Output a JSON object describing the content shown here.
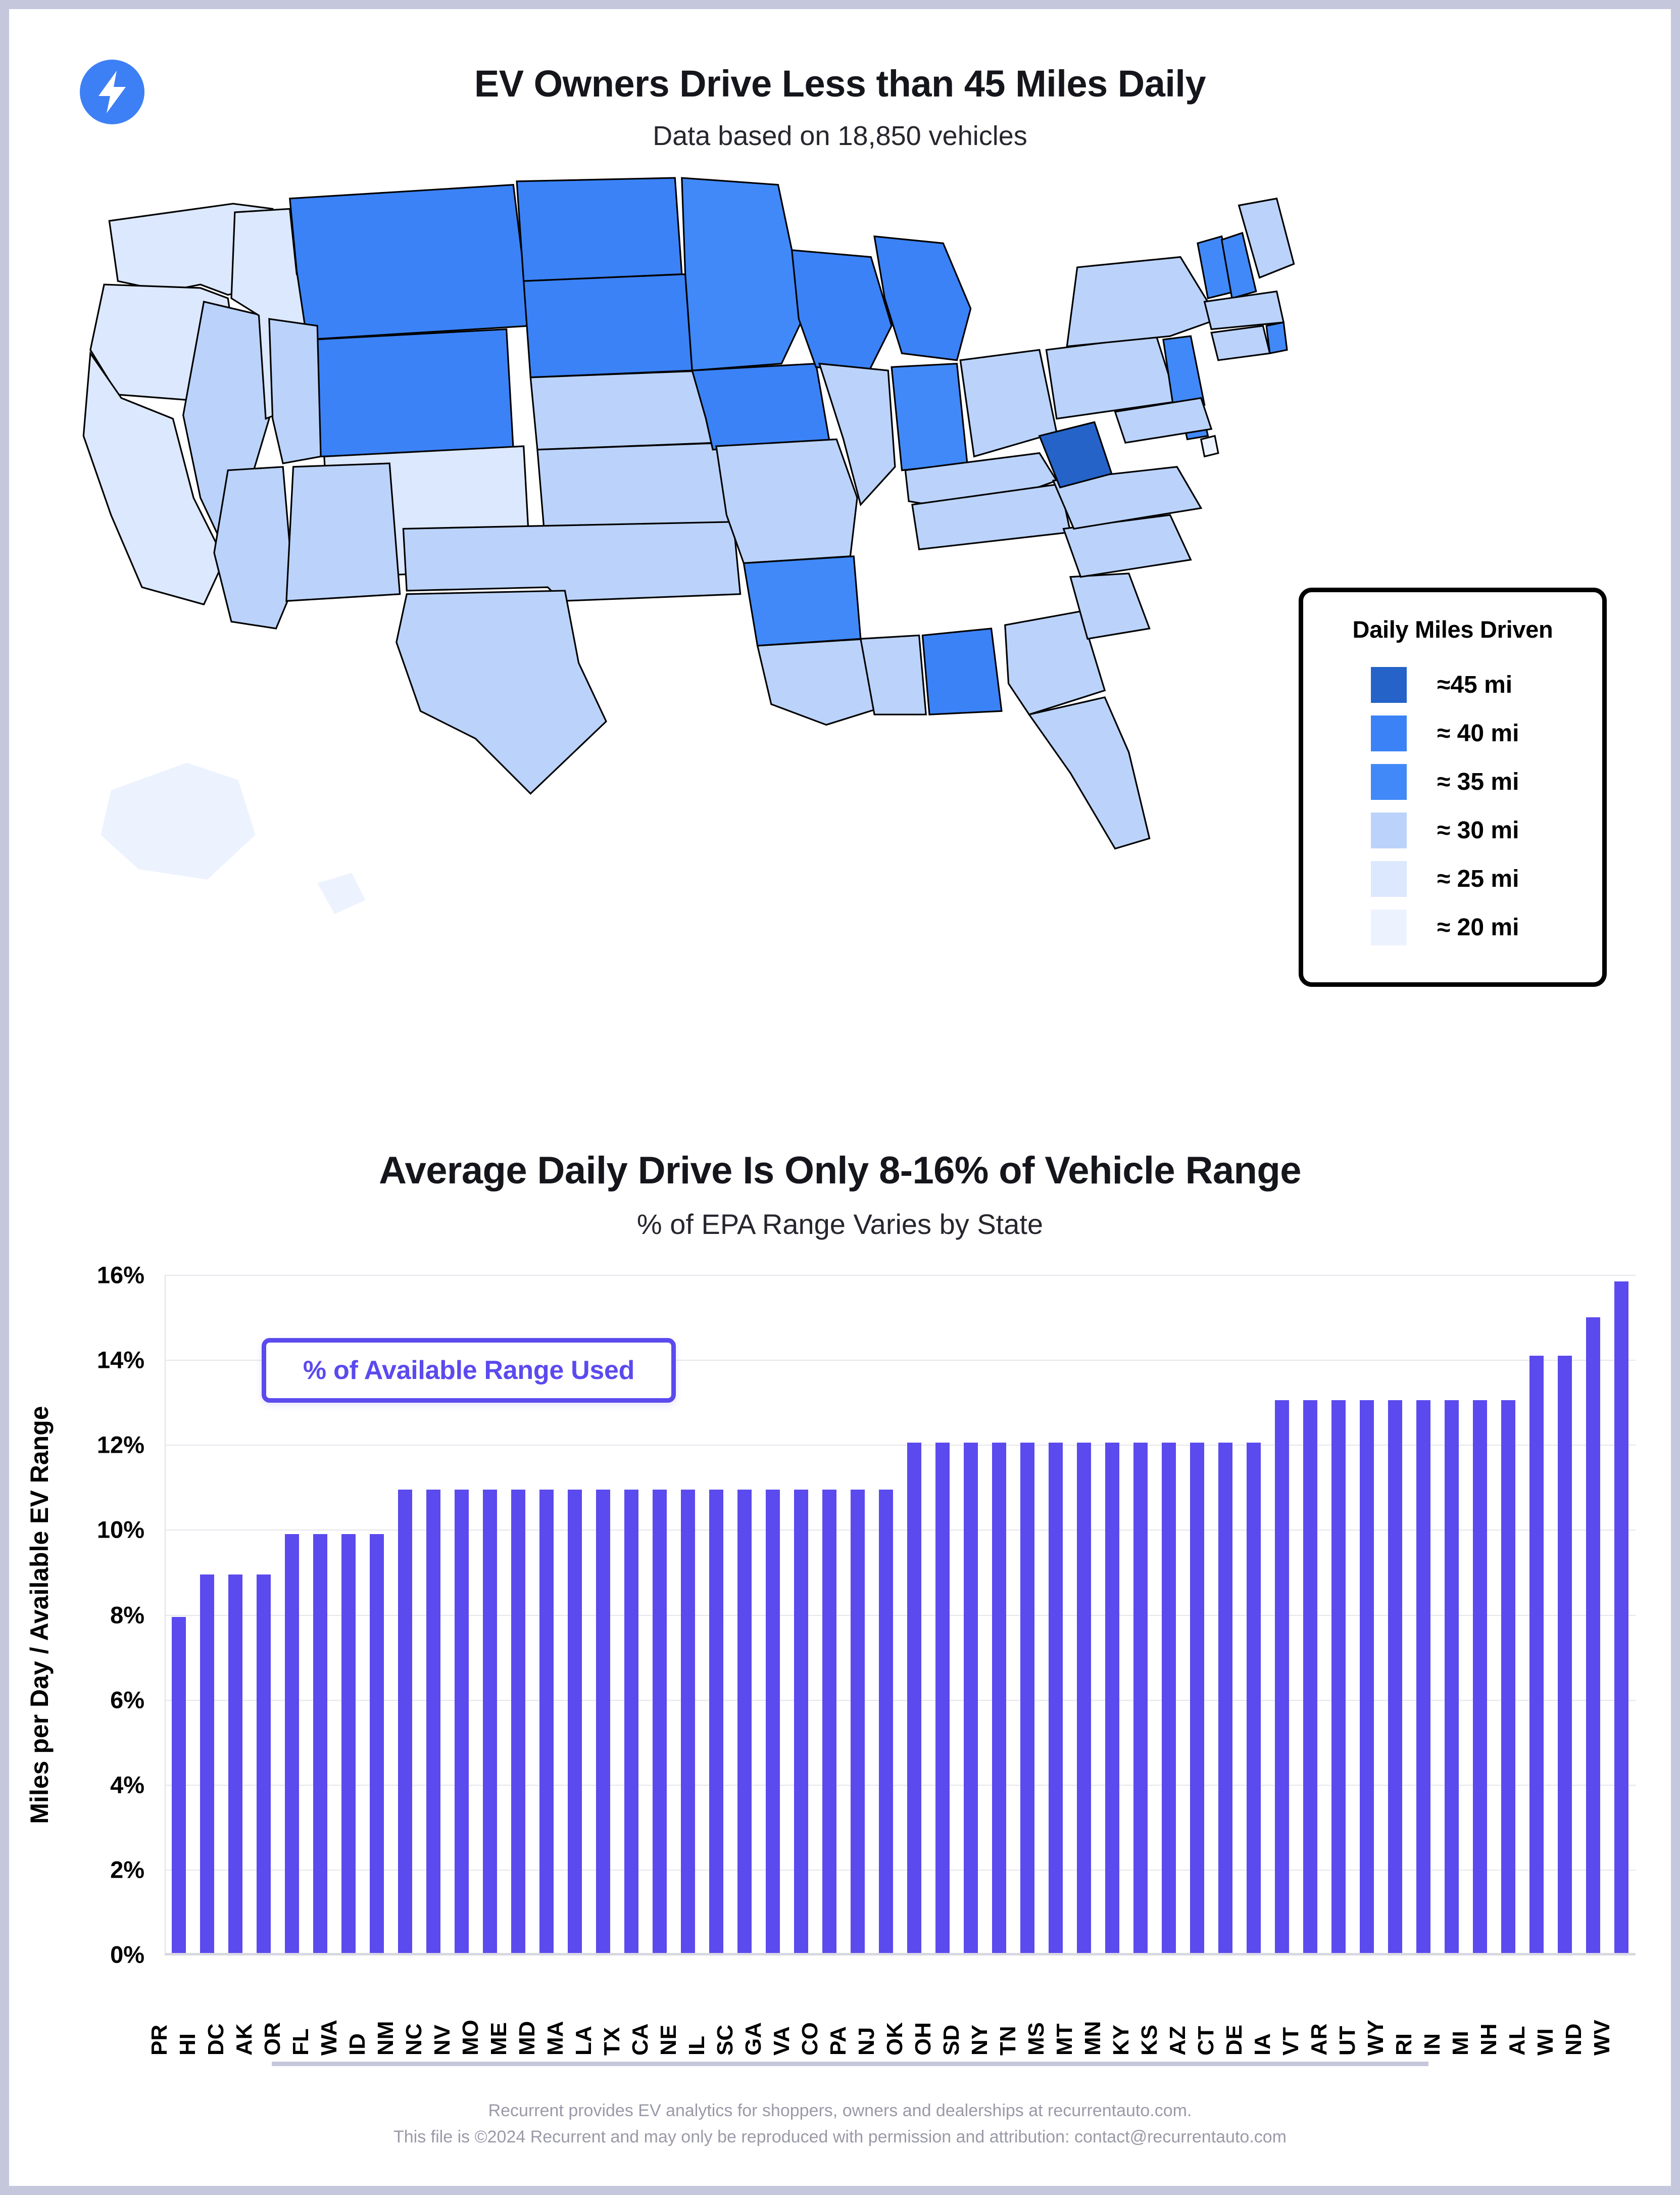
{
  "header": {
    "logo_icon": "lightning-bolt-icon",
    "logo_color": "#3D7FF5",
    "title": "EV Owners Drive Less than 45 Miles Daily",
    "subtitle": "Data based on 18,850 vehicles"
  },
  "map": {
    "legend": {
      "title": "Daily Miles Driven",
      "items": [
        {
          "label": "≈45 mi",
          "color": "#2563C8"
        },
        {
          "label": "≈ 40 mi",
          "color": "#3B82F6"
        },
        {
          "label": "≈ 35 mi",
          "color": "#4189F8"
        },
        {
          "label": "≈ 30 mi",
          "color": "#BBD3FB"
        },
        {
          "label": "≈ 25 mi",
          "color": "#DCE8FD"
        },
        {
          "label": "≈ 20 mi",
          "color": "#EDF3FE"
        }
      ]
    },
    "state_bins": {
      "WV": 0,
      "MT": 1,
      "ND": 1,
      "SD": 1,
      "WY": 1,
      "IA": 1,
      "MI": 1,
      "WI": 1,
      "AL": 1,
      "AR": 2,
      "NJ": 2,
      "VT": 2,
      "NH": 2,
      "IN": 2,
      "MN": 2,
      "MO": 3,
      "NE": 3,
      "KS": 3,
      "IL": 3,
      "OH": 3,
      "KY": 3,
      "PA": 3,
      "VA": 3,
      "NC": 3,
      "SC": 3,
      "TN": 3,
      "MS": 3,
      "LA": 3,
      "OK": 3,
      "TX": 3,
      "NM": 3,
      "UT": 3,
      "CO": 4,
      "AZ": 3,
      "NV": 3,
      "ID": 4,
      "OR": 4,
      "WA": 4,
      "CA": 4,
      "GA": 3,
      "FL": 3,
      "ME": 3,
      "NY": 3,
      "MA": 3,
      "CT": 3,
      "RI": 2,
      "DE": 2,
      "MD": 3,
      "AK": 5,
      "HI": 5,
      "DC": 5,
      "PR": 5
    }
  },
  "chart_data": {
    "type": "bar",
    "title": "Average Daily Drive Is Only 8-16% of Vehicle Range",
    "subtitle": "% of EPA Range Varies by State",
    "legend_label": "% of Available Range Used",
    "legend_position": "top-left-inside",
    "series_color": "#5B4AEE",
    "xlabel": "",
    "ylabel": "Miles per Day / Available EV Range",
    "ylim": [
      0,
      16
    ],
    "ytick_labels": [
      "0%",
      "2%",
      "4%",
      "6%",
      "8%",
      "10%",
      "12%",
      "14%",
      "16%"
    ],
    "ytick_values": [
      0,
      2,
      4,
      6,
      8,
      10,
      12,
      14,
      16
    ],
    "grid": true,
    "categories": [
      "PR",
      "HI",
      "DC",
      "AK",
      "OR",
      "FL",
      "WA",
      "ID",
      "NM",
      "NC",
      "NV",
      "MO",
      "ME",
      "MD",
      "MA",
      "LA",
      "TX",
      "CA",
      "NE",
      "IL",
      "SC",
      "GA",
      "VA",
      "CO",
      "PA",
      "NJ",
      "OK",
      "OH",
      "SD",
      "NY",
      "TN",
      "MS",
      "MT",
      "MN",
      "KY",
      "KS",
      "AZ",
      "CT",
      "DE",
      "IA",
      "VT",
      "AR",
      "UT",
      "WY",
      "RI",
      "IN",
      "MI",
      "NH",
      "AL",
      "WI",
      "ND",
      "WV"
    ],
    "values": [
      7.95,
      8.95,
      8.95,
      8.95,
      9.9,
      9.9,
      9.9,
      9.9,
      10.95,
      10.95,
      10.95,
      10.95,
      10.95,
      10.95,
      10.95,
      10.95,
      10.95,
      10.95,
      10.95,
      10.95,
      10.95,
      10.95,
      10.95,
      10.95,
      10.95,
      10.95,
      12.05,
      12.05,
      12.05,
      12.05,
      12.05,
      12.05,
      12.05,
      12.05,
      12.05,
      12.05,
      12.05,
      12.05,
      12.05,
      13.05,
      13.05,
      13.05,
      13.05,
      13.05,
      13.05,
      13.05,
      13.05,
      13.05,
      14.1,
      14.1,
      15.0,
      15.85
    ]
  },
  "footer": {
    "line1": "Recurrent provides EV analytics for shoppers, owners and dealerships at recurrentauto.com.",
    "line2": "This file is ©2024 Recurrent and may only be reproduced with permission and attribution: contact@recurrentauto.com"
  }
}
